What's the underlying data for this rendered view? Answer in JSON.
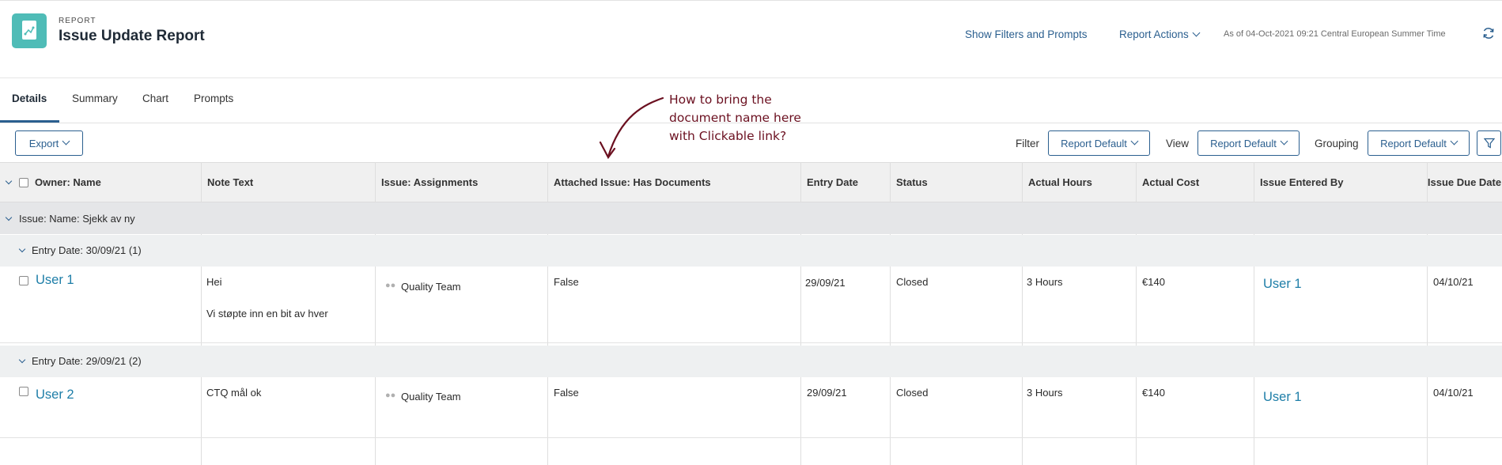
{
  "header": {
    "kicker": "REPORT",
    "title": "Issue Update Report",
    "show_filters": "Show Filters and Prompts",
    "report_actions": "Report Actions",
    "as_of": "As of 04-Oct-2021 09:21 Central European Summer Time",
    "refresh_icon": "refresh-icon",
    "accent": "#2b5f8f",
    "logo_color": "#4fbcb7"
  },
  "tabs": [
    {
      "label": "Details",
      "active": true
    },
    {
      "label": "Summary",
      "active": false
    },
    {
      "label": "Chart",
      "active": false
    },
    {
      "label": "Prompts",
      "active": false
    }
  ],
  "toolbar": {
    "export_label": "Export",
    "filter_label": "Filter",
    "filter_value": "Report Default",
    "view_label": "View",
    "view_value": "Report Default",
    "grouping_label": "Grouping",
    "grouping_value": "Report Default"
  },
  "annotation": {
    "text": "How to bring the\ndocument name here\nwith Clickable link?",
    "color": "#6b1020"
  },
  "table": {
    "columns": [
      "Owner: Name",
      "Note Text",
      "Issue: Assignments",
      "Attached Issue: Has Documents",
      "Entry Date",
      "Status",
      "Actual Hours",
      "Actual Cost",
      "Issue Entered By",
      "Issue Due Date"
    ],
    "group": "Issue: Name: Sjekk av ny",
    "subgroups": [
      {
        "label": "Entry Date: 30/09/21 (1)",
        "row": {
          "owner": "User 1",
          "note_line1": "Hei",
          "note_line2": "Vi støpte inn en bit av hver",
          "assignment": "Quality Team",
          "has_documents": "False",
          "entry_date": "29/09/21",
          "status": "Closed",
          "hours": "3 Hours",
          "cost": "€140",
          "entered_by": "User 1",
          "due_date": "04/10/21"
        }
      },
      {
        "label": "Entry Date: 29/09/21 (2)",
        "row": {
          "owner": "User 2",
          "note_line1": "CTQ mål ok",
          "assignment": "Quality Team",
          "has_documents": "False",
          "entry_date": "29/09/21",
          "status": "Closed",
          "hours": "3 Hours",
          "cost": "€140",
          "entered_by": "User 1",
          "due_date": "04/10/21"
        }
      }
    ]
  }
}
